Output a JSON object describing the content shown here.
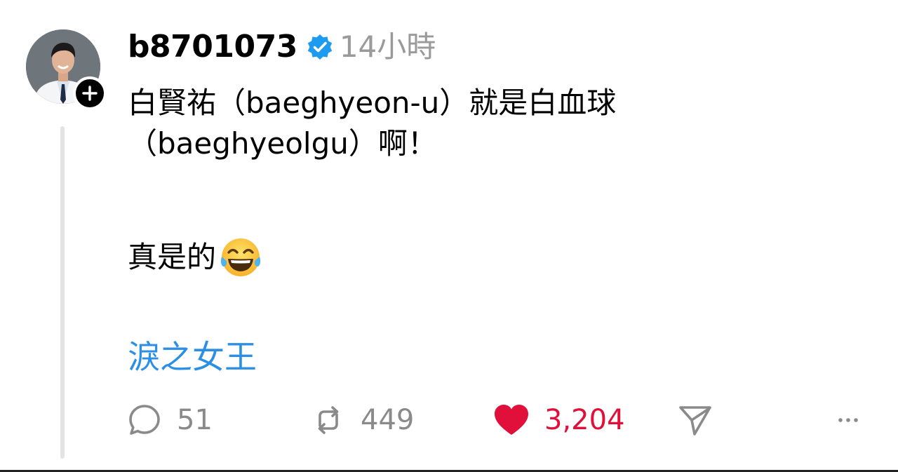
{
  "post": {
    "username": "b8701073",
    "verified": true,
    "timestamp": "14小時",
    "body_line1": "白賢祐（baeghyeon-u）就是白血球",
    "body_line2": "（baeghyeolgu）啊！",
    "body_line3": "真是的",
    "emoji": "face-with-tears-of-joy",
    "tag": "淚之女王"
  },
  "actions": {
    "replies": "51",
    "reposts": "449",
    "likes": "3,204",
    "liked": true
  },
  "colors": {
    "verified_blue": "#1d9bf0",
    "like_red": "#e0103a",
    "tag_blue": "#2c8fe6",
    "muted_gray": "#8a8a8a"
  }
}
